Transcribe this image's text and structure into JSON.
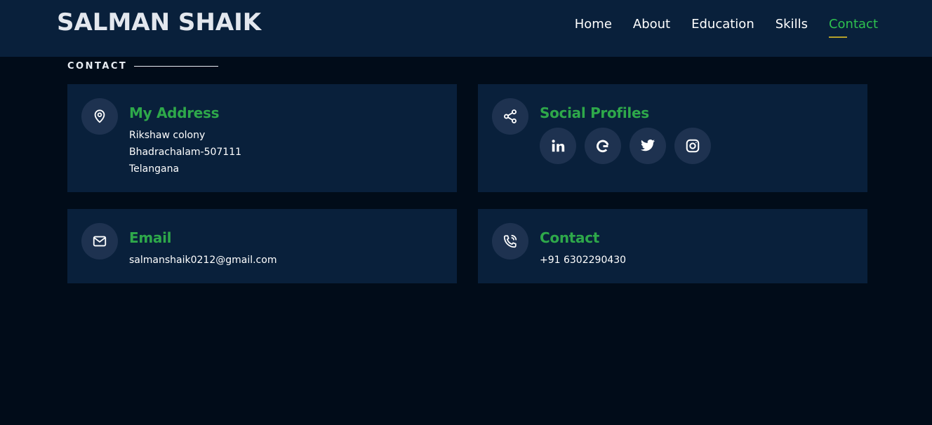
{
  "header": {
    "logo": "SALMAN SHAIK",
    "nav": [
      {
        "label": "Home"
      },
      {
        "label": "About"
      },
      {
        "label": "Education"
      },
      {
        "label": "Skills"
      },
      {
        "label": "Contact"
      }
    ],
    "active_nav": "Contact"
  },
  "section": {
    "title": "CONTACT"
  },
  "address": {
    "title": "My Address",
    "lines": [
      "Rikshaw colony",
      "Bhadrachalam-507111",
      "Telangana"
    ],
    "icon": "location-pin-icon"
  },
  "social": {
    "title": "Social Profiles",
    "icon": "share-icon",
    "profiles": [
      {
        "icon": "linkedin-icon"
      },
      {
        "icon": "google-icon"
      },
      {
        "icon": "twitter-icon"
      },
      {
        "icon": "instagram-icon"
      }
    ]
  },
  "email": {
    "title": "Email",
    "value": "salmanshaik0212@gmail.com",
    "icon": "envelope-icon"
  },
  "contact": {
    "title": "Contact",
    "value": "+91 6302290430",
    "icon": "phone-icon"
  },
  "colors": {
    "background": "#010c19",
    "header": "#09203b",
    "card": "#09203b",
    "accent_green": "#2ea84a",
    "nav_active": "#2ec14f",
    "underline": "#b5a12b",
    "icon_circle": "#1e3250"
  }
}
